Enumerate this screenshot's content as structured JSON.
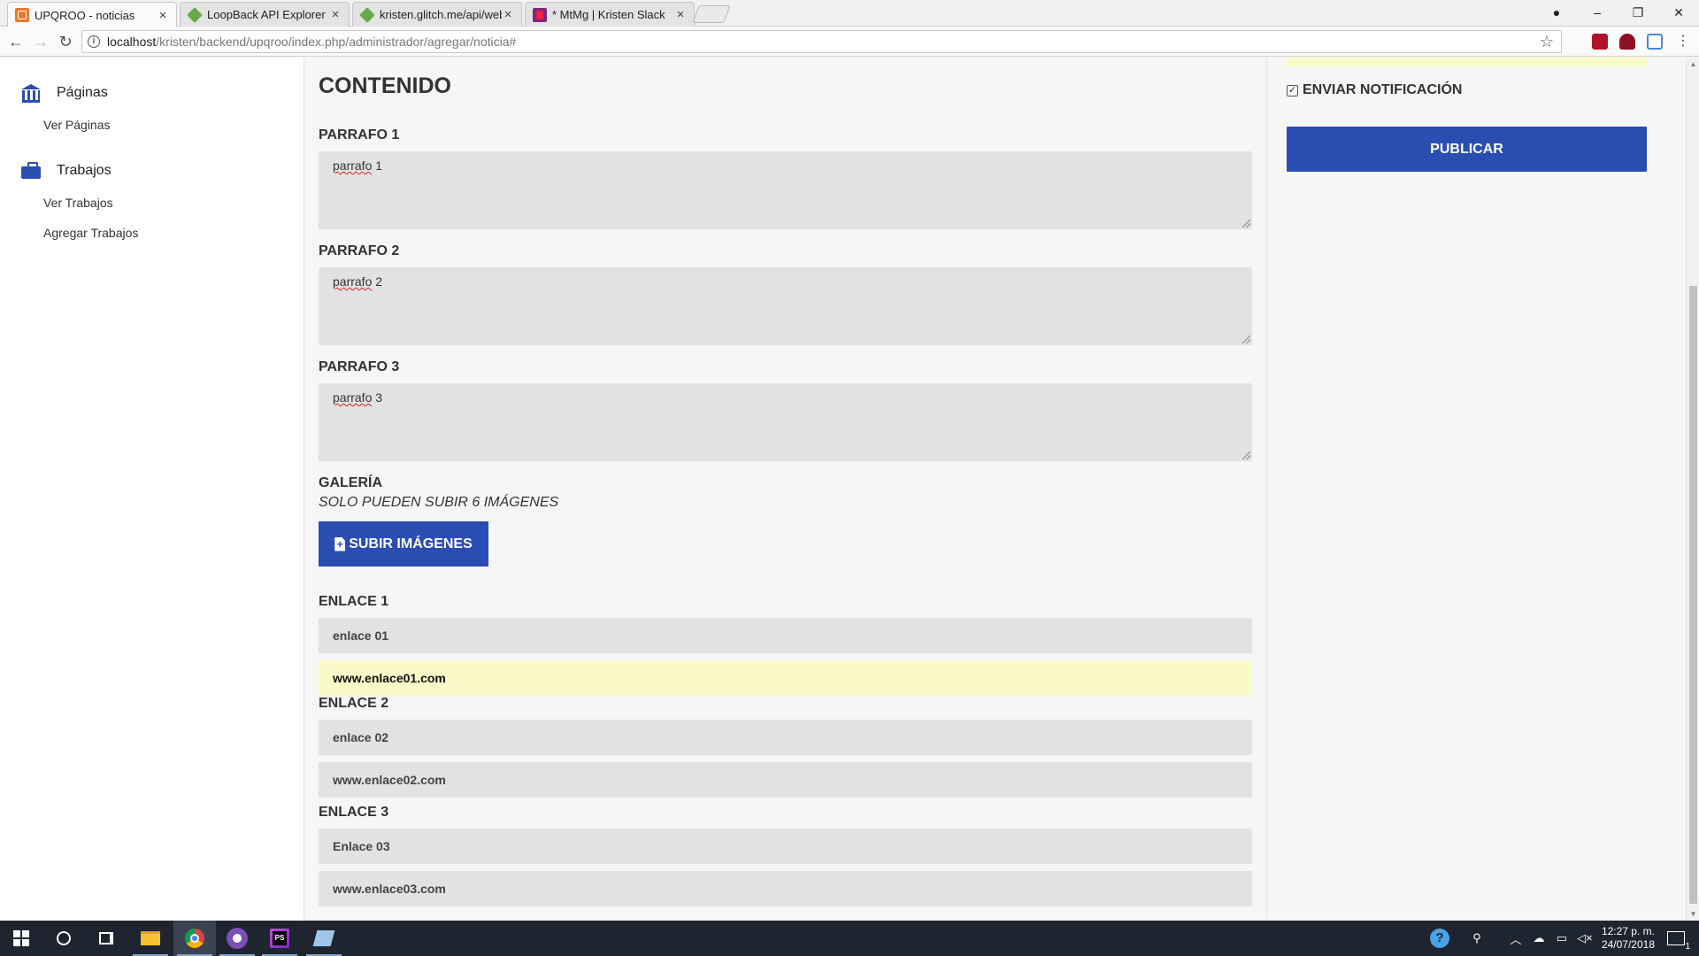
{
  "browser": {
    "tabs": [
      {
        "label": "UPQROO - noticias",
        "icon": "upqroo-favicon"
      },
      {
        "label": "LoopBack API Explorer",
        "icon": "loopback-favicon"
      },
      {
        "label": "kristen.glitch.me/api/web",
        "icon": "loopback-favicon"
      },
      {
        "label": "* MtMg | Kristen Slack",
        "icon": "slack-favicon"
      }
    ],
    "url_host": "localhost",
    "url_path": "/kristen/backend/upqroo/index.php/administrador/agregar/noticia#"
  },
  "sidebar": {
    "sections": [
      {
        "title": "Páginas",
        "icon": "bank-icon",
        "links": [
          "Ver Páginas"
        ]
      },
      {
        "title": "Trabajos",
        "icon": "briefcase-icon",
        "links": [
          "Ver Trabajos",
          "Agregar Trabajos"
        ]
      }
    ]
  },
  "content": {
    "title": "CONTENIDO",
    "paragraphs": [
      {
        "label": "PARRAFO 1",
        "word": "parrafo",
        "num": "1"
      },
      {
        "label": "PARRAFO 2",
        "word": "parrafo",
        "num": "2"
      },
      {
        "label": "PARRAFO 3",
        "word": "parrafo",
        "num": "3"
      }
    ],
    "gallery": {
      "label": "GALERÍA",
      "subtitle": "SOLO PUEDEN SUBIR 6 IMÁGENES",
      "button": "SUBIR IMÁGENES"
    },
    "links": [
      {
        "label": "ENLACE 1",
        "name": "enlace 01",
        "url": "www.enlace01.com"
      },
      {
        "label": "ENLACE 2",
        "name": "enlace 02",
        "url": "www.enlace02.com"
      },
      {
        "label": "ENLACE 3",
        "name": "Enlace 03",
        "url": "www.enlace03.com"
      }
    ]
  },
  "right_panel": {
    "notify_label": "ENVIAR NOTIFICACIÓN",
    "notify_checked": true,
    "publish_button": "PUBLICAR"
  },
  "taskbar": {
    "time": "12:27 p. m.",
    "date": "24/07/2018"
  },
  "colors": {
    "accent": "#2a4db1",
    "autofill": "#fafac8",
    "input_bg": "#e2e2e2",
    "taskbar": "#1e2530"
  }
}
